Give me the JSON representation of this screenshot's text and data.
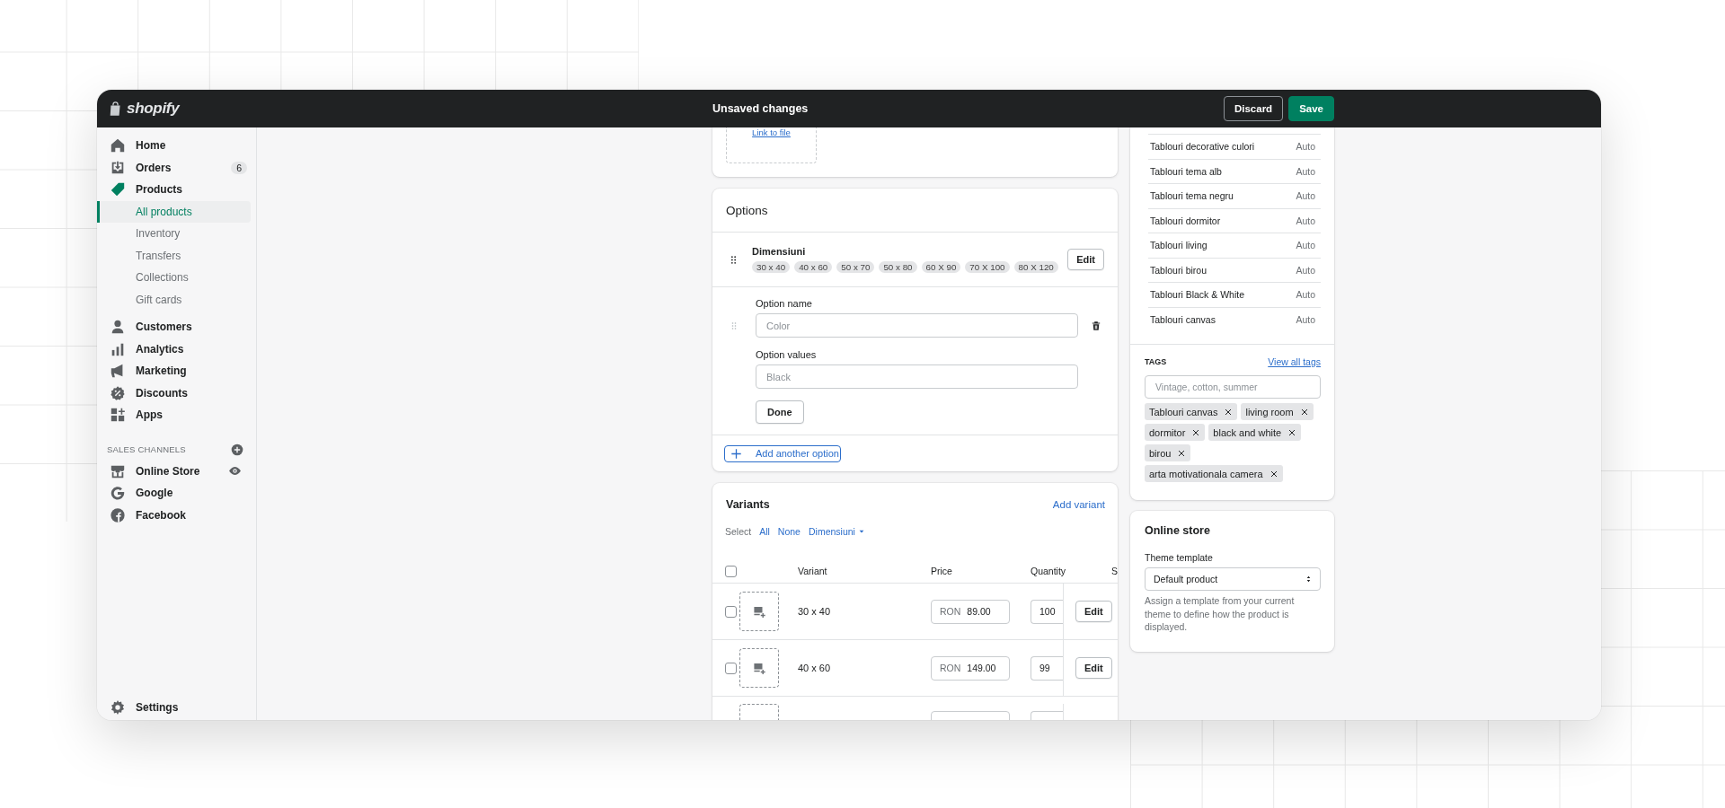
{
  "topbar": {
    "logo": "shopify",
    "title": "Unsaved changes",
    "buttons": [
      {
        "label": "Discard",
        "kind": "secondary"
      },
      {
        "label": "Save",
        "kind": "primary"
      }
    ]
  },
  "sidebar": {
    "items": [
      {
        "label": "Home",
        "selected": false
      },
      {
        "label": "Orders",
        "selected": false,
        "badge": "6"
      },
      {
        "label": "Products",
        "selected": false,
        "children": [
          {
            "label": "All products",
            "selected": true
          },
          {
            "label": "Inventory",
            "selected": false
          },
          {
            "label": "Transfers",
            "selected": false
          },
          {
            "label": "Collections",
            "selected": false
          },
          {
            "label": "Gift cards",
            "selected": false
          }
        ]
      },
      {
        "label": "Customers",
        "selected": false
      },
      {
        "label": "Analytics",
        "selected": false
      },
      {
        "label": "Marketing",
        "selected": false
      },
      {
        "label": "Discounts",
        "selected": false
      },
      {
        "label": "Apps",
        "selected": false
      }
    ],
    "channels_heading": "SALES CHANNELS",
    "channels": [
      {
        "label": "Online Store",
        "selected": false
      },
      {
        "label": "Google",
        "selected": false
      },
      {
        "label": "Facebook",
        "selected": false
      }
    ],
    "footer": {
      "label": "Settings",
      "selected": false
    }
  },
  "media": {
    "link": "Link to file"
  },
  "options": {
    "title": "Options",
    "option": {
      "name": "Dimensiuni",
      "values": [
        "30 x 40",
        "40 x 60",
        "50 x 70",
        "50 x 80",
        "60 X 90",
        "70 X 100",
        "80 X 120"
      ],
      "button": "Edit"
    },
    "editor": {
      "name_label": "Option name",
      "name_placeholder": "Color",
      "values_label": "Option values",
      "values_placeholder": "Black",
      "button": "Done"
    },
    "add_button": "Add another option"
  },
  "variants": {
    "title": "Variants",
    "add_link": "Add variant",
    "select_label": "Select",
    "select_links": [
      {
        "label": "All",
        "kind": "link"
      },
      {
        "label": "None",
        "kind": "link"
      },
      {
        "label": "Dimensiuni",
        "kind": "dropdown"
      }
    ],
    "all_selected": false,
    "columns": [
      "Variant",
      "Price",
      "Quantity",
      "S"
    ],
    "rows": [
      {
        "kind": "full",
        "selected": false,
        "name": "30 x 40",
        "currency": "RON",
        "price": "89.00",
        "quantity": "100",
        "button": "Edit"
      },
      {
        "kind": "full",
        "selected": false,
        "name": "40 x 60",
        "currency": "RON",
        "price": "149.00",
        "quantity": "99",
        "button": "Edit"
      },
      {
        "kind": "partial"
      }
    ]
  },
  "collections": {
    "rows": [
      {
        "name": "Tablouri decorative culori",
        "status": "Auto"
      },
      {
        "name": "Tablouri tema alb",
        "status": "Auto"
      },
      {
        "name": "Tablouri tema negru",
        "status": "Auto"
      },
      {
        "name": "Tablouri dormitor",
        "status": "Auto"
      },
      {
        "name": "Tablouri living",
        "status": "Auto"
      },
      {
        "name": "Tablouri birou",
        "status": "Auto"
      },
      {
        "name": "Tablouri Black & White",
        "status": "Auto"
      },
      {
        "name": "Tablouri canvas",
        "status": "Auto"
      }
    ]
  },
  "tags": {
    "title": "TAGS",
    "link": "View all tags",
    "placeholder": "Vintage, cotton, summer",
    "items": [
      "Tablouri canvas",
      "living room",
      "dormitor",
      "black and white",
      "birou",
      "arta motivationala camera"
    ]
  },
  "online_store": {
    "title": "Online store",
    "label": "Theme template",
    "value": "Default product",
    "help": "Assign a template from your current theme to define how the product is displayed."
  }
}
